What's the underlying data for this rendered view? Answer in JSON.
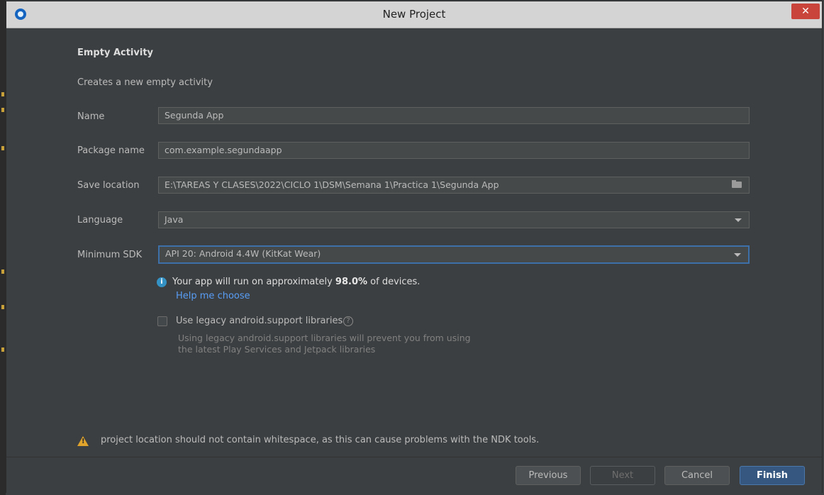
{
  "window": {
    "title": "New Project",
    "close_glyph": "✕"
  },
  "activity": {
    "heading": "Empty Activity",
    "description": "Creates a new empty activity"
  },
  "form": {
    "name_label": "Name",
    "name_value": "Segunda App",
    "package_label": "Package name",
    "package_value": "com.example.segundaapp",
    "location_label": "Save location",
    "location_value": "E:\\TAREAS Y CLASES\\2022\\CICLO 1\\DSM\\Semana 1\\Practica 1\\Segunda App",
    "language_label": "Language",
    "language_value": "Java",
    "sdk_label": "Minimum SDK",
    "sdk_value": "API 20: Android 4.4W (KitKat Wear)"
  },
  "info": {
    "text_before": "Your app will run on approximately ",
    "percent": "98.0%",
    "text_after": " of devices.",
    "help_link": "Help me choose"
  },
  "legacy": {
    "checkbox_label": "Use legacy android.support libraries",
    "checked": false,
    "hint_line1": "Using legacy android.support libraries will prevent you from using",
    "hint_line2": "the latest Play Services and Jetpack libraries"
  },
  "warning": "project location should not contain whitespace, as this can cause problems with the NDK tools.",
  "buttons": {
    "previous": "Previous",
    "next": "Next",
    "cancel": "Cancel",
    "finish": "Finish"
  },
  "icons": {
    "app": "android-studio-icon",
    "info": "info-icon",
    "help": "question-icon",
    "warning": "warning-icon",
    "folder": "folder-icon",
    "dropdown": "chevron-down-icon"
  },
  "colors": {
    "accent": "#365880",
    "link": "#589df6",
    "warning": "#e0a32c",
    "close": "#c9453b"
  }
}
